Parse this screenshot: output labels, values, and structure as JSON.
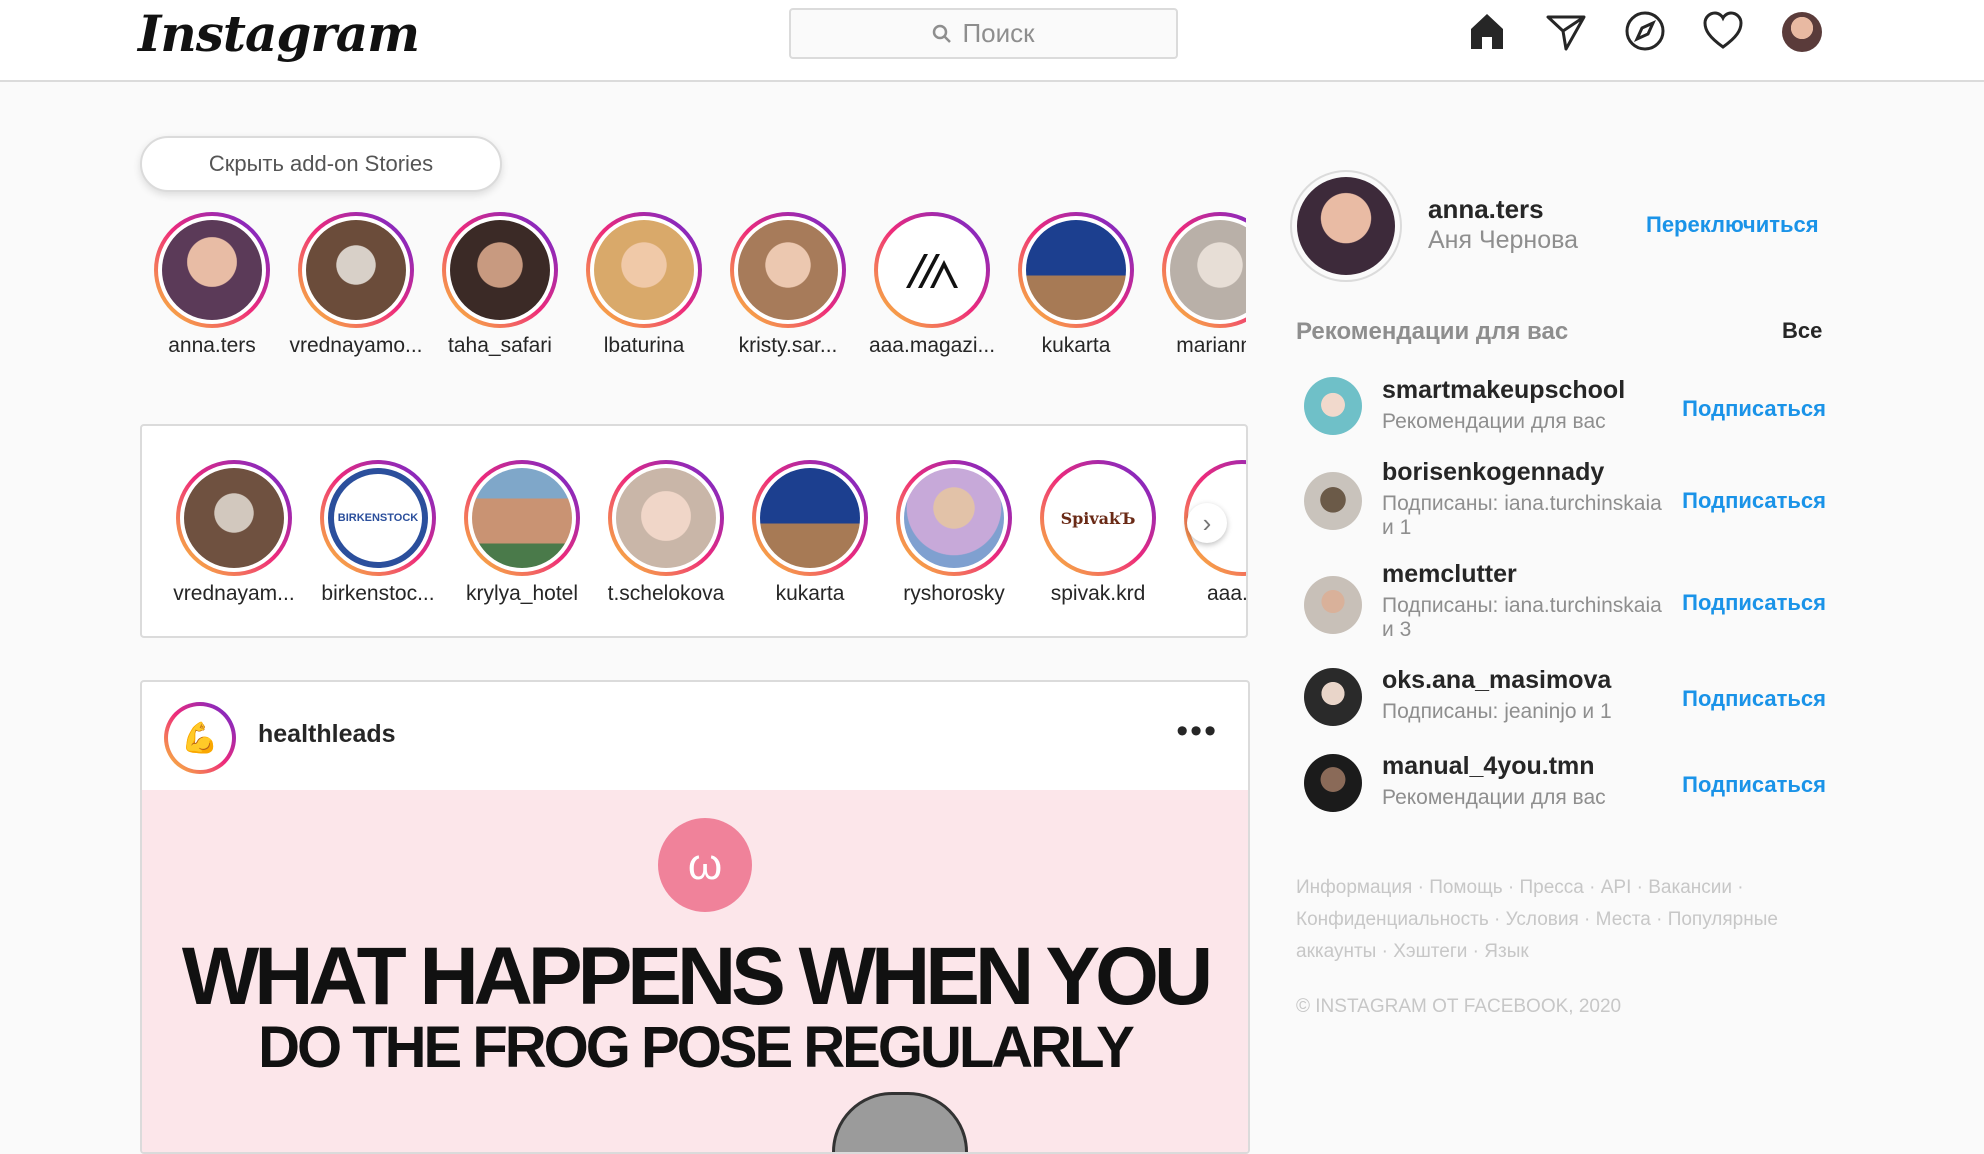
{
  "header": {
    "logo": "Instagram",
    "search_placeholder": "Поиск",
    "nav_icons": [
      "home-icon",
      "direct-icon",
      "explore-icon",
      "activity-icon",
      "profile-avatar"
    ]
  },
  "stories": {
    "hide_button": "Скрыть add-on Stories",
    "row1": [
      {
        "name": "anna.ters"
      },
      {
        "name": "vrednayamo..."
      },
      {
        "name": "taha_safari"
      },
      {
        "name": "lbaturina"
      },
      {
        "name": "kristy.sar..."
      },
      {
        "name": "aaa.magazi..."
      },
      {
        "name": "kukarta"
      },
      {
        "name": "marianna"
      }
    ],
    "row2": [
      {
        "name": "vrednayam..."
      },
      {
        "name": "birkenstoc..."
      },
      {
        "name": "krylya_hotel"
      },
      {
        "name": "t.schelokova"
      },
      {
        "name": "kukarta"
      },
      {
        "name": "ryshorosky"
      },
      {
        "name": "spivak.krd"
      },
      {
        "name": "aaa.ma"
      }
    ]
  },
  "post": {
    "username": "healthleads",
    "more": "•••",
    "headline1": "WHAT HAPPENS WHEN YOU",
    "headline2": "DO THE FROG POSE REGULARLY"
  },
  "sidebar": {
    "username": "anna.ters",
    "full_name": "Аня Чернова",
    "switch": "Переключиться",
    "rec_title": "Рекомендации для вас",
    "rec_all": "Все",
    "recommendations": [
      {
        "user": "smartmakeupschool",
        "sub": "Рекомендации для вас",
        "action": "Подписаться"
      },
      {
        "user": "borisenkogennady",
        "sub": "Подписаны: iana.turchinskaia и 1",
        "action": "Подписаться"
      },
      {
        "user": "memclutter",
        "sub": "Подписаны: iana.turchinskaia и 3",
        "action": "Подписаться"
      },
      {
        "user": "oks.ana_masimova",
        "sub": "Подписаны: jeaninjo и 1",
        "action": "Подписаться"
      },
      {
        "user": "manual_4you.tmn",
        "sub": "Рекомендации для вас",
        "action": "Подписаться"
      }
    ],
    "footer_links": "Информация · Помощь · Пресса · API · Вакансии · Конфиденциальность · Условия · Места · Популярные аккаунты · Хэштеги · Язык",
    "copyright": "© INSTAGRAM ОТ FACEBOOK, 2020"
  },
  "colors": {
    "link": "#1a93e8",
    "border": "#dbdbdb",
    "muted": "#8e8e8e"
  }
}
